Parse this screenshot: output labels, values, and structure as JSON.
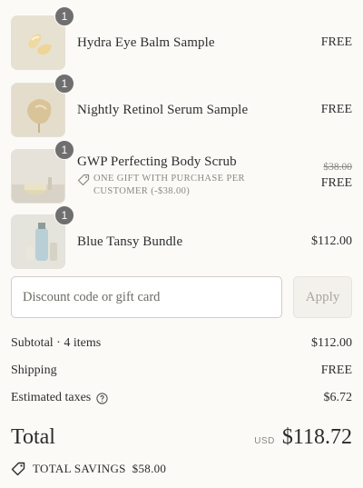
{
  "items": [
    {
      "name": "Hydra Eye Balm Sample",
      "qty": "1",
      "price": "FREE"
    },
    {
      "name": "Nightly Retinol Serum Sample",
      "qty": "1",
      "price": "FREE"
    },
    {
      "name": "GWP Perfecting Body Scrub",
      "qty": "1",
      "original_price": "$38.00",
      "price": "FREE",
      "discount_line1": "ONE GIFT WITH PURCHASE PER",
      "discount_line2": "CUSTOMER (-$38.00)"
    },
    {
      "name": "Blue Tansy Bundle",
      "qty": "1",
      "price": "$112.00"
    }
  ],
  "discount": {
    "placeholder": "Discount code or gift card",
    "apply_label": "Apply"
  },
  "summary": {
    "subtotal_label": "Subtotal · 4 items",
    "subtotal_value": "$112.00",
    "shipping_label": "Shipping",
    "shipping_value": "FREE",
    "taxes_label": "Estimated taxes",
    "taxes_value": "$6.72"
  },
  "total": {
    "label": "Total",
    "currency": "USD",
    "value": "$118.72"
  },
  "savings": {
    "label": "TOTAL SAVINGS",
    "value": "$58.00"
  },
  "icons": {
    "discount_tag": "tag-icon",
    "tax_info": "question-circle-icon",
    "savings": "tag-icon"
  }
}
